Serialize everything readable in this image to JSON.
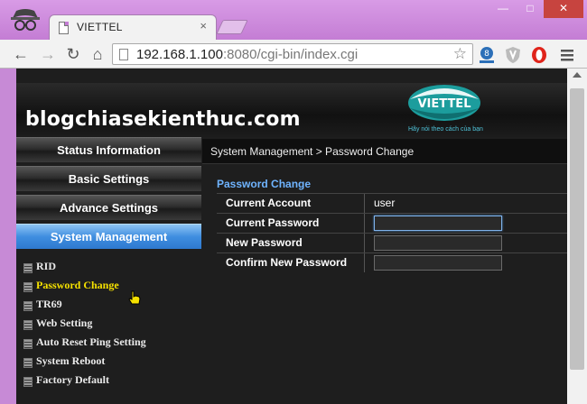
{
  "browser": {
    "tab_title": "VIETTEL",
    "tab_close": "×",
    "url_host": "192.168.1.100",
    "url_rest": ":8080/cgi-bin/index.cgi",
    "window_buttons": {
      "minimize": "—",
      "maximize": "□",
      "close": "✕"
    },
    "nav": {
      "back": "←",
      "forward": "→",
      "reload": "↻",
      "home": "⌂"
    },
    "star": "☆"
  },
  "site": {
    "banner_text": "blogchiasekienthuc.com",
    "logo_text": "VIETTEL",
    "logo_slogan": "Hãy nói theo cách của bạn"
  },
  "menu": [
    {
      "label": "Status Information",
      "active": false
    },
    {
      "label": "Basic Settings",
      "active": false
    },
    {
      "label": "Advance Settings",
      "active": false
    },
    {
      "label": "System Management",
      "active": true
    }
  ],
  "submenu": [
    {
      "label": "RID"
    },
    {
      "label": "Password Change",
      "current": true
    },
    {
      "label": "TR69"
    },
    {
      "label": "Web Setting"
    },
    {
      "label": "Auto Reset Ping Setting"
    },
    {
      "label": "System Reboot"
    },
    {
      "label": "Factory Default"
    }
  ],
  "content": {
    "breadcrumb": "System Management > Password Change",
    "section_title": "Password Change",
    "rows": [
      {
        "label": "Current Account",
        "value": "user"
      },
      {
        "label": "Current Password",
        "input_value": ""
      },
      {
        "label": "New Password",
        "input_value": ""
      },
      {
        "label": "Confirm New Password",
        "input_value": ""
      }
    ]
  },
  "colors": {
    "title_bar": "#c47dd4",
    "menu_active": "#3f8ee0",
    "section_title": "#6fb4ff",
    "current_sub_item": "#f5e100"
  }
}
